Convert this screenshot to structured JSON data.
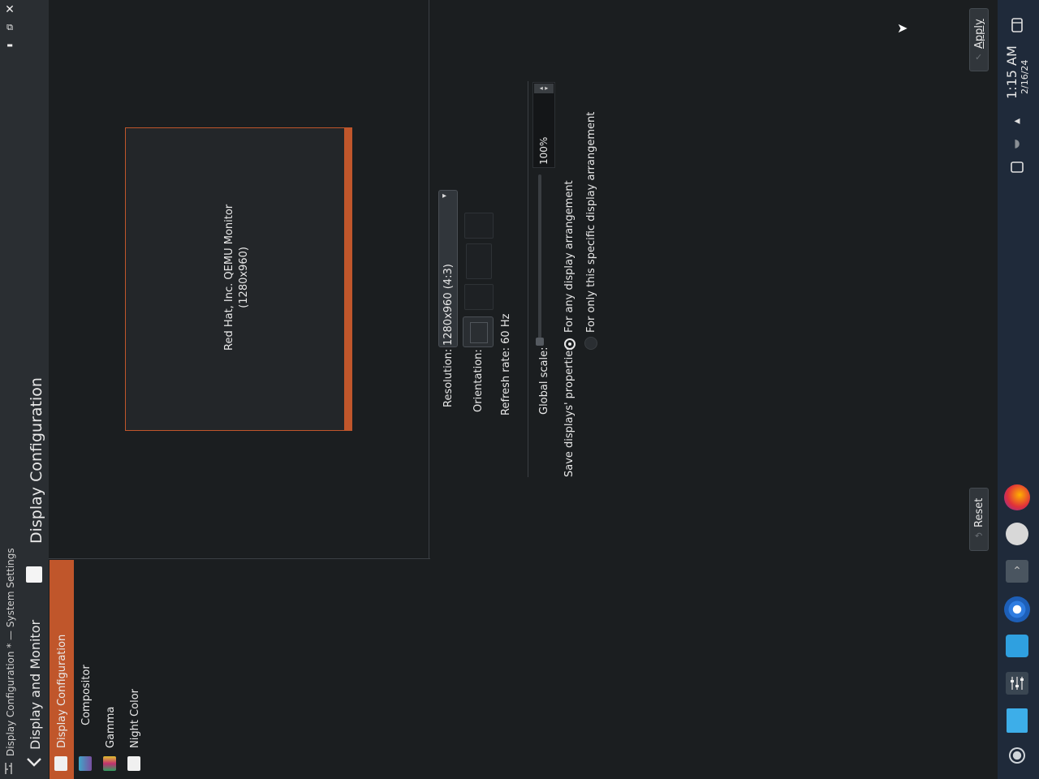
{
  "window": {
    "title": "Display Configuration * — System Settings",
    "close_glyph": "✕",
    "maximize_glyph": "⧉",
    "minimize_glyph": "▬"
  },
  "sidebar": {
    "header": "Display and Monitor",
    "items": [
      {
        "label": "Display Configuration",
        "selected": true
      },
      {
        "label": "Compositor",
        "selected": false
      },
      {
        "label": "Gamma",
        "selected": false
      },
      {
        "label": "Night Color",
        "selected": false
      }
    ]
  },
  "main": {
    "title": "Display Configuration",
    "monitor": {
      "name": "Red Hat, Inc. QEMU Monitor",
      "resolution_label": "(1280x960)"
    },
    "resolution": {
      "label": "Resolution:",
      "value": "1280x960 (4:3)"
    },
    "orientation": {
      "label": "Orientation:"
    },
    "refresh_rate": {
      "label": "Refresh rate: 60 Hz"
    },
    "global_scale": {
      "label": "Global scale:",
      "value": "100%",
      "level": 0.0
    },
    "save_properties": {
      "label": "Save displays' properties:",
      "options": [
        {
          "label": "For any display arrangement",
          "checked": true
        },
        {
          "label": "For only this specific display arrangement",
          "checked": false
        }
      ]
    },
    "buttons": {
      "apply": "Apply",
      "reset": "Reset"
    }
  },
  "taskbar": {
    "time": "1:15 AM",
    "date": "2/16/24"
  },
  "colors": {
    "accent": "#c0562b",
    "background": "#1b1e20",
    "panel": "#232629",
    "taskbar": "#1f2a3a"
  },
  "icons": [
    "close-icon",
    "maximize-icon",
    "minimize-icon",
    "back-icon",
    "display-icon",
    "compositor-icon",
    "gamma-icon",
    "night-color-icon",
    "orientation-icon",
    "volume-icon",
    "network-icon",
    "clipboard-icon",
    "firefox-icon",
    "app-icon",
    "chromium-icon",
    "files-icon",
    "mixer-icon",
    "dolphin-icon",
    "application-launcher-icon"
  ]
}
